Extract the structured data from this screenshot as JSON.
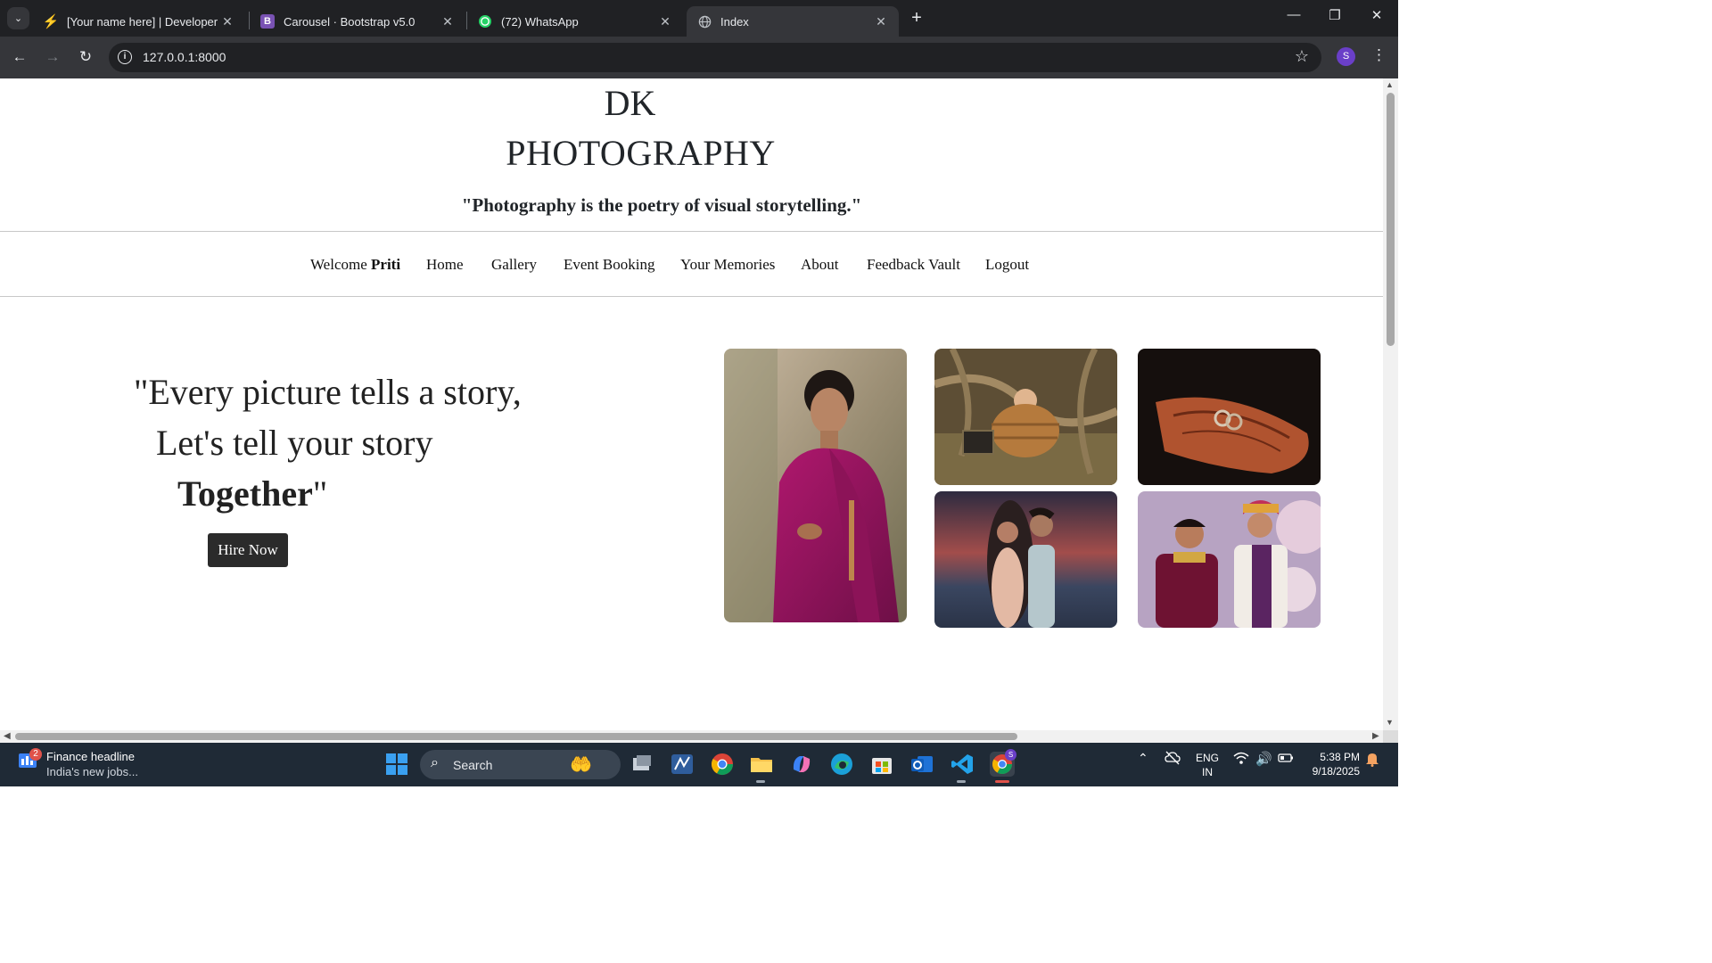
{
  "browser": {
    "tabs": [
      {
        "title": "[Your name here] | Developer",
        "icon": "lightning-icon",
        "active": false
      },
      {
        "title": "Carousel · Bootstrap v5.0",
        "icon": "bootstrap-icon",
        "active": false
      },
      {
        "title": "(72) WhatsApp",
        "icon": "whatsapp-icon",
        "active": false
      },
      {
        "title": "Index",
        "icon": "globe-icon",
        "active": true
      }
    ],
    "url": "127.0.0.1:8000",
    "profile_initial": "S",
    "window_controls": {
      "minimize": "—",
      "restore": "❐",
      "close": "✕"
    }
  },
  "site": {
    "brand_line1": "DK",
    "brand_line2": "PHOTOGRAPHY",
    "tagline": "\"Photography is the poetry of visual storytelling.\"",
    "nav": {
      "welcome_prefix": "Welcome",
      "welcome_name": "Priti",
      "items": [
        "Home",
        "Gallery",
        "Event Booking",
        "Your Memories",
        "About",
        "Feedback Vault",
        "Logout"
      ]
    },
    "hero": {
      "line1": "\"Every picture tells a story,",
      "line2": "Let's tell your story",
      "line3_bold": "Together",
      "line3_end": "\"",
      "cta": "Hire Now"
    },
    "gallery": [
      {
        "subject": "woman in magenta saree"
      },
      {
        "subject": "baby in basket"
      },
      {
        "subject": "hennaed hands with rings"
      },
      {
        "subject": "couple at sunset beach"
      },
      {
        "subject": "bride and groom in traditional attire"
      }
    ]
  },
  "taskbar": {
    "widget_badge": "2",
    "news_title": "Finance headline",
    "news_sub": "India's new jobs...",
    "search_label": "Search",
    "lang1": "ENG",
    "lang2": "IN",
    "time": "5:38 PM",
    "date": "9/18/2025",
    "chrome_profile_badge": "S"
  }
}
